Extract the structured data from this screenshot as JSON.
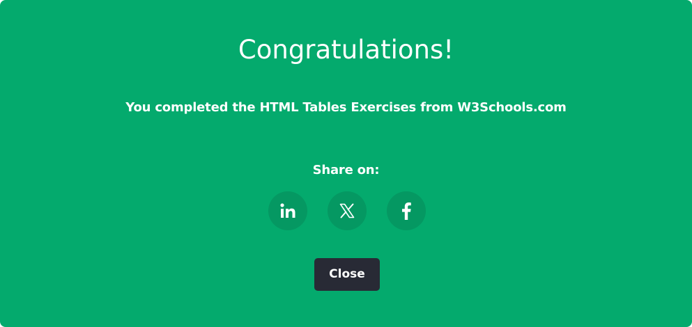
{
  "modal": {
    "title": "Congratulations!",
    "message": "You completed the HTML Tables Exercises from W3Schools.com",
    "share_label": "Share on:",
    "share_buttons": [
      {
        "icon": "linkedin-icon",
        "label": "LinkedIn"
      },
      {
        "icon": "x-icon",
        "label": "X"
      },
      {
        "icon": "facebook-icon",
        "label": "Facebook"
      }
    ],
    "close_label": "Close"
  },
  "colors": {
    "modal_background": "#04aa6d",
    "share_button_background": "#059862",
    "close_button_background": "#282a35",
    "text": "#ffffff"
  }
}
